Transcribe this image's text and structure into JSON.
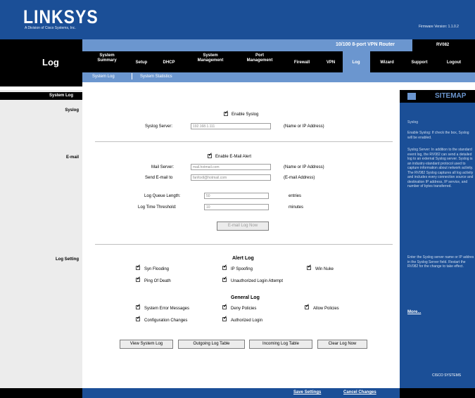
{
  "brand": {
    "logo": "LINKSYS",
    "tagline": "A Division of Cisco Systems, Inc.",
    "firmware": "Firmware Version: 1.1.0.2"
  },
  "product": {
    "name": "10/100 8-port VPN Router",
    "model": "RV082"
  },
  "page_title": "Log",
  "nav": {
    "items": [
      {
        "label": "System Summary",
        "active": false
      },
      {
        "label": "Setup",
        "active": false
      },
      {
        "label": "DHCP",
        "active": false
      },
      {
        "label": "System Management",
        "active": false
      },
      {
        "label": "Port Management",
        "active": false
      },
      {
        "label": "Firewall",
        "active": false
      },
      {
        "label": "VPN",
        "active": false
      },
      {
        "label": "Log",
        "active": true
      },
      {
        "label": "Wizard",
        "active": false
      },
      {
        "label": "Support",
        "active": false
      },
      {
        "label": "Logout",
        "active": false
      }
    ],
    "sub": [
      "System Log",
      "System Statistics"
    ]
  },
  "left": {
    "section": "System Log",
    "syslog": "Syslog",
    "email": "E-mail",
    "log_setting": "Log Setting"
  },
  "syslog": {
    "enable_label": "Enable Syslog",
    "server_label": "Syslog Server:",
    "server_value": "192.168.1.111",
    "server_hint": "(Name or IP Address)"
  },
  "email": {
    "enable_label": "Enable E-Mail Alert",
    "mail_server_label": "Mail Server:",
    "mail_server_value": "mail.hotmail.com",
    "mail_server_hint": "(Name or IP Address)",
    "send_to_label": "Send E-mail to",
    "send_to_value": "fanfoxtl@hotmail.com",
    "send_to_hint": "(E-mail Address)",
    "queue_label": "Log Queue Length:",
    "queue_value": "50",
    "queue_unit": "entries",
    "threshold_label": "Log Time Threshold:",
    "threshold_value": "10",
    "threshold_unit": "minutes",
    "email_now": "E-mail Log Now"
  },
  "log_setting": {
    "alert_title": "Alert Log",
    "general_title": "General Log",
    "alert": [
      {
        "label": "Syn Flooding",
        "checked": true
      },
      {
        "label": "IP Spoofing",
        "checked": true
      },
      {
        "label": "Win Nuke",
        "checked": true
      },
      {
        "label": "Ping Of Death",
        "checked": true
      },
      {
        "label": "Unauthorized Login Attempt",
        "checked": true
      }
    ],
    "general": [
      {
        "label": "System Error Messages",
        "checked": true
      },
      {
        "label": "Deny Policies",
        "checked": true
      },
      {
        "label": "Allow Policies",
        "checked": true
      },
      {
        "label": "Configuration Changes",
        "checked": true
      },
      {
        "label": "Authorized Login",
        "checked": true
      }
    ]
  },
  "buttons": {
    "view_system_log": "View System Log",
    "outgoing": "Outgoing Log Table",
    "incoming": "Incoming Log Table",
    "clear": "Clear Log Now"
  },
  "sitemap": {
    "title": "SITEMAP",
    "p0": "Syslog",
    "p1": "Enable Syslog: If check the box, Syslog will be enabled.",
    "p2": "Syslog Server: In addition to the standard event log, the RV082 can send a detailed log to an external Syslog server. Syslog is an industry-standard protocol used to capture information about network activity. The RV082 Syslog captures all log activity and includes every connection source and destination IP address, IP service, and number of bytes transferred.",
    "p3": "Enter the Syslog server name or IP addres in the Syslog Server field. Restart the RV082 for the change to take effect.",
    "more": "More...",
    "cisco": "CISCO SYSTEMS"
  },
  "footer": {
    "save": "Save Settings",
    "cancel": "Cancel Changes"
  }
}
